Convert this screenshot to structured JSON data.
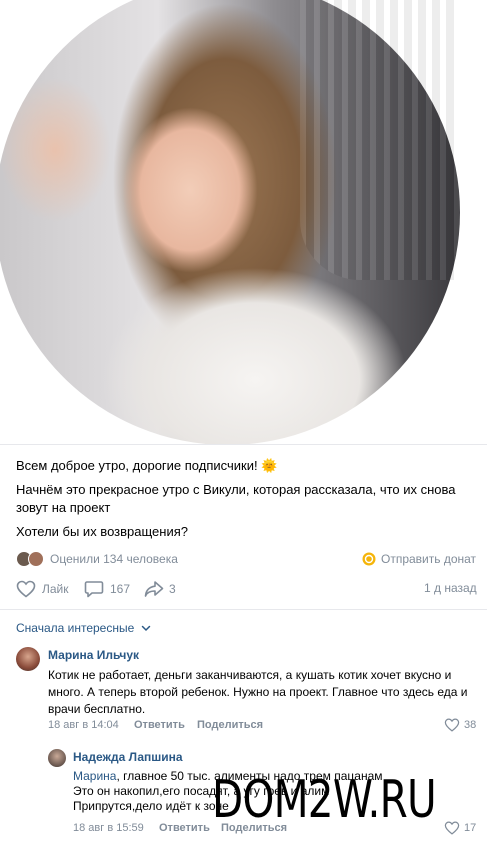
{
  "post": {
    "line1": "Всем доброе утро, дорогие подписчики!",
    "line2": "Начнём это прекрасное утро с Викули, которая рассказала, что их снова зовут на проект ",
    "line3": "Хотели бы их возвращения?",
    "sun_emoji": "🌞",
    "ratings_text": "Оценили 134 человека",
    "donate_text": "Отправить донат",
    "like_label": "Лайк",
    "comments_count": "167",
    "shares_count": "3",
    "time": "1 д назад"
  },
  "sort": {
    "label": "Сначала интересные"
  },
  "comments": [
    {
      "author": "Марина Ильчук",
      "text": "Котик не работает, деньги заканчиваются, а кушать котик хочет вкусно и много. А теперь второй ребенок. Нужно на проект. Главное что здесь еда и врачи бесплатно.",
      "date": "18 авг в 14:04",
      "reply_label": "Ответить",
      "share_label": "Поделиться",
      "likes": "38"
    }
  ],
  "reply": {
    "author": "Надежда Лапшина",
    "mention": "Марина",
    "line1": ", главное 50 тыс. алименты надо трем пацанам",
    "line2": "Это он накопил,его посадят, а угу грев и алим",
    "line3": "Припрутся,дело идёт к зоне",
    "date": "18 авг в 15:59",
    "reply_label": "Ответить",
    "share_label": "Поделиться",
    "likes": "17"
  },
  "watermark": "DOM2W.RU",
  "colors": {
    "accent": "#2a5885",
    "muted": "#818c99",
    "divider": "#e7e8ec",
    "donate": "#f5b50a"
  }
}
